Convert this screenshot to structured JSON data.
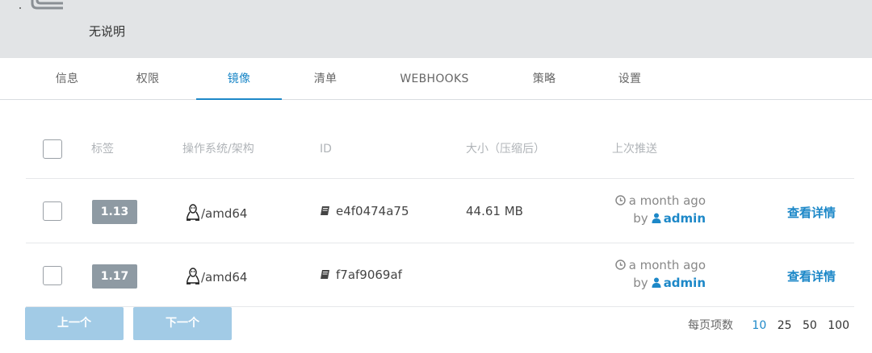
{
  "header": {
    "description": "无说明"
  },
  "tabs": [
    {
      "label": "信息"
    },
    {
      "label": "权限"
    },
    {
      "label": "镜像"
    },
    {
      "label": "清单"
    },
    {
      "label": "WEBHOOKS"
    },
    {
      "label": "策略"
    },
    {
      "label": "设置"
    }
  ],
  "active_tab": "镜像",
  "table": {
    "columns": [
      "标签",
      "操作系统/架构",
      "ID",
      "大小（压缩后）",
      "上次推送"
    ],
    "rows": [
      {
        "tag": "1.13",
        "os_arch": "/amd64",
        "id": "e4f0474a75",
        "size": "44.61 MB",
        "pushed": "a month ago",
        "by_label": "by",
        "user": "admin",
        "action": "查看详情"
      },
      {
        "tag": "1.17",
        "os_arch": "/amd64",
        "id": "f7af9069af",
        "size": "",
        "pushed": "a month ago",
        "by_label": "by",
        "user": "admin",
        "action": "查看详情"
      }
    ]
  },
  "pagination": {
    "prev_label": "上一个",
    "next_label": "下一个",
    "page_size_label": "每页项数",
    "page_sizes": [
      "10",
      "25",
      "50",
      "100"
    ],
    "selected_page_size": "10"
  },
  "icons": {
    "repo": "repository-stack-icon",
    "os": "linux-penguin-icon",
    "id": "book-icon",
    "time": "clock-icon",
    "user": "user-icon"
  },
  "colors": {
    "accent": "#1d88c8",
    "header_bg": "#e2e4e6",
    "tag_badge": "#8e9aa3",
    "button_disabled": "#a2cbe6"
  }
}
